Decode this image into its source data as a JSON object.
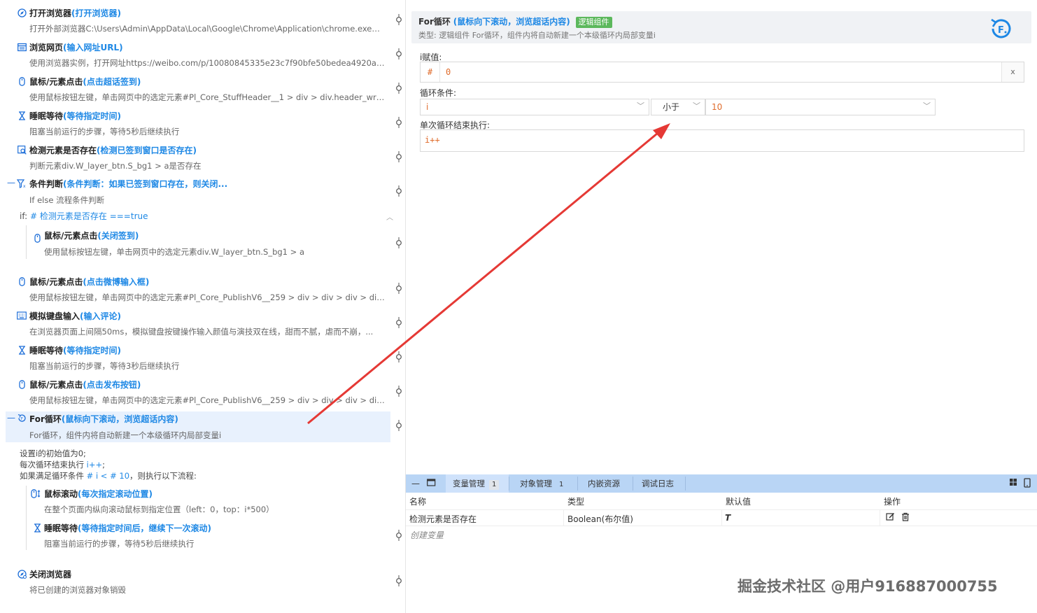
{
  "steps": [
    {
      "name": "打开浏览器",
      "alias": "(打开浏览器)",
      "desc": "打开外部浏览器C:\\Users\\Admin\\AppData\\Local\\Google\\Chrome\\Application\\chrome.exe，设..."
    },
    {
      "name": "浏览网页",
      "alias": "(输入网址URL)",
      "desc": "使用浏览器实例，打开网址https://weibo.com/p/10080845335e23c7f90bfe50bedea4920a5940..."
    },
    {
      "name": "鼠标/元素点击",
      "alias": "(点击超话签到)",
      "desc": "使用鼠标按钮左键，单击网页中的选定元素#Pl_Core_StuffHeader__1 > div > div.header_wrap..."
    },
    {
      "name": "睡眠等待",
      "alias": "(等待指定时间)",
      "desc": "阻塞当前运行的步骤，等待5秒后继续执行"
    },
    {
      "name": "检测元素是否存在",
      "alias": "(检测已签到窗口是否存在)",
      "desc": "判断元素div.W_layer_btn.S_bg1 > a是否存在"
    },
    {
      "name": "条件判断",
      "alias": "(条件判断：如果已签到窗口存在，则关闭...",
      "desc": "If else 流程条件判断"
    },
    {
      "name": "鼠标/元素点击",
      "alias": "(关闭签到)",
      "desc": "使用鼠标按钮左键，单击网页中的选定元素div.W_layer_btn.S_bg1 > a"
    },
    {
      "name": "鼠标/元素点击",
      "alias": "(点击微博输入框)",
      "desc": "使用鼠标按钮左键，单击网页中的选定元素#Pl_Core_PublishV6__259 > div > div > div > div >..."
    },
    {
      "name": "模拟键盘输入",
      "alias": "(输入评论)",
      "desc": "在浏览器页面上间隔50ms，模拟键盘按键操作输入颜值与演技双在线，甜而不腻，虐而不崩，..."
    },
    {
      "name": "睡眠等待",
      "alias": "(等待指定时间)",
      "desc": "阻塞当前运行的步骤，等待3秒后继续执行"
    },
    {
      "name": "鼠标/元素点击",
      "alias": "(点击发布按钮)",
      "desc": "使用鼠标按钮左键，单击网页中的选定元素#Pl_Core_PublishV6__259 > div > div > div > div >..."
    },
    {
      "name": "For循环",
      "alias": "(鼠标向下滚动，浏览超话内容)",
      "desc": "For循环，组件内将自动新建一个本级循环内局部变量i"
    },
    {
      "name": "鼠标滚动",
      "alias": "(每次指定滚动位置)",
      "desc": "在整个页面内纵向滚动鼠标到指定位置（left：0，top：i*500）"
    },
    {
      "name": "睡眠等待",
      "alias": "(等待指定时间后，继续下一次滚动)",
      "desc": "阻塞当前运行的步骤，等待5秒后继续执行"
    },
    {
      "name": "关闭浏览器",
      "alias": "",
      "desc": "将已创建的浏览器对象销毁"
    }
  ],
  "if_line": {
    "key": "if:",
    "cond": "# 检测元素是否存在 ===true"
  },
  "summary": {
    "line1": "设置i的初始值为0;",
    "line2_a": "每次循环结束执行 ",
    "line2_b": "i++",
    "line2_c": ";",
    "line3_a": "如果满足循环条件 ",
    "line3_b": "# i < # 10",
    "line3_c": "，则执行以下流程:"
  },
  "header": {
    "name": "For循环",
    "alias": "(鼠标向下滚动，浏览超话内容)",
    "badge": "逻辑组件",
    "type": "类型:   逻辑组件 For循环，组件内将自动新建一个本级循环内局部变量i"
  },
  "form": {
    "assign_label": "i赋值:",
    "assign_prefix": "#",
    "assign_value": "0",
    "clear": "x",
    "cond_label": "循环条件:",
    "cond_var": "i",
    "cond_op": "小于",
    "cond_val": "10",
    "exec_label": "单次循环结束执行:",
    "exec_value": "i++"
  },
  "bottom": {
    "tabs": [
      {
        "label": "变量管理",
        "count": "1"
      },
      {
        "label": "对象管理",
        "count": "1"
      },
      {
        "label": "内嵌资源",
        "count": ""
      },
      {
        "label": "调试日志",
        "count": ""
      }
    ],
    "columns": [
      "名称",
      "类型",
      "默认值",
      "操作"
    ],
    "rows": [
      {
        "name": "检测元素是否存在",
        "type": "Boolean(布尔值)",
        "default": "T"
      }
    ],
    "create": "创建变量"
  },
  "watermark": "掘金技术社区 @用户916887000755",
  "colors": {
    "accent": "#1e88e5",
    "badge": "#5cb85c",
    "code": "#e06c2c",
    "tabbar": "#b9d5f5",
    "arrow": "#e53935"
  }
}
